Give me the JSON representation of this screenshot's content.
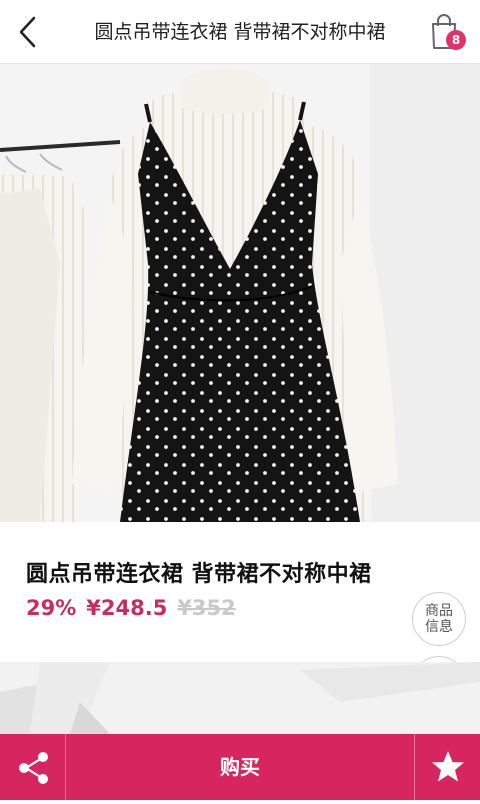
{
  "header": {
    "title": "圆点吊带连衣裙 背带裙不对称中裙",
    "cart_count": "8"
  },
  "product": {
    "title": "圆点吊带连衣裙 背带裙不对称中裙",
    "discount": "29%",
    "price": "¥248.5",
    "original_price": "¥352"
  },
  "side_buttons": {
    "info_line1": "商品",
    "info_line2": "信息"
  },
  "bottom_bar": {
    "buy_label": "购买"
  },
  "colors": {
    "accent": "#d72560",
    "price": "#c62d62",
    "badge": "#e0336e"
  },
  "icons": {
    "back": "chevron-left-icon",
    "cart": "shopping-bag-icon",
    "share": "share-icon",
    "favorite": "star-icon",
    "scroll_top": "arrow-up-icon"
  }
}
